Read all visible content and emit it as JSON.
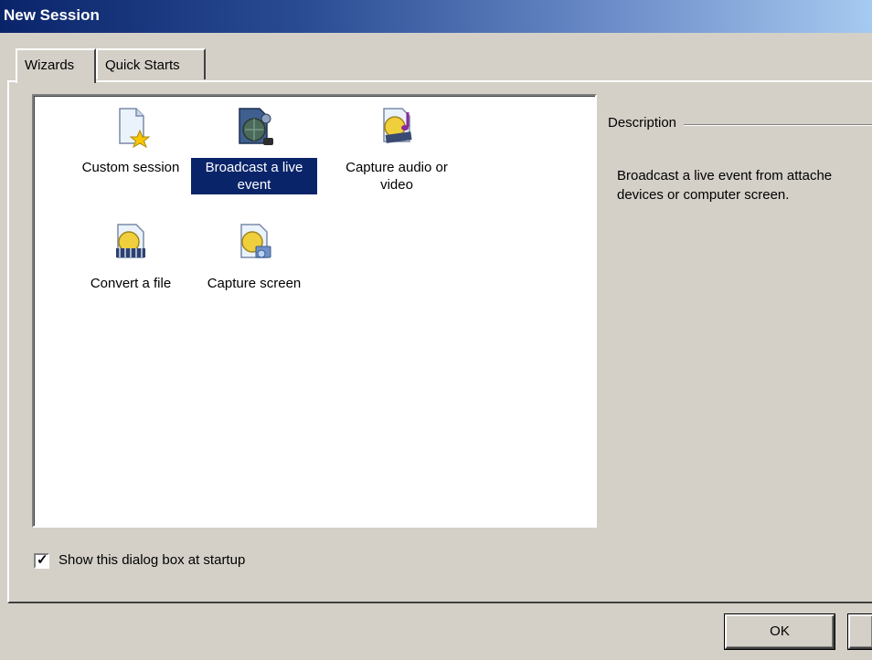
{
  "window": {
    "title": "New Session"
  },
  "tabs": [
    {
      "label": "Wizards",
      "active": true
    },
    {
      "label": "Quick Starts",
      "active": false
    }
  ],
  "wizards": [
    {
      "label": "Custom session",
      "icon": "document-star-icon",
      "selected": false
    },
    {
      "label": "Broadcast a live event",
      "icon": "broadcast-icon",
      "selected": true
    },
    {
      "label": "Capture audio or video",
      "icon": "capture-audio-video-icon",
      "selected": false
    },
    {
      "label": "Convert a file",
      "icon": "convert-file-icon",
      "selected": false
    },
    {
      "label": "Capture screen",
      "icon": "capture-screen-icon",
      "selected": false
    }
  ],
  "description": {
    "heading": "Description",
    "line1": "Broadcast a live event from attache",
    "line2": "devices or computer screen."
  },
  "startup_checkbox": {
    "label": "Show this dialog box at startup",
    "checked": true
  },
  "buttons": {
    "ok": "OK"
  }
}
